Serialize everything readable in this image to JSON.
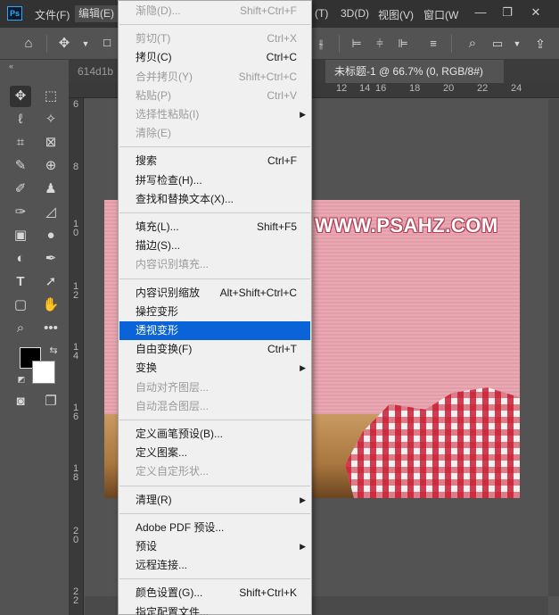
{
  "app": {
    "logo": "Ps",
    "menus": [
      "文件(F)",
      "编辑(E)",
      "(T)",
      "3D(D)",
      "视图(V)",
      "窗口(W"
    ],
    "window_controls": [
      "—",
      "❐",
      "✕"
    ]
  },
  "options_bar": {
    "icons": [
      "home-icon",
      "move-icon",
      "align-icon",
      "search-icon",
      "workspace-icon",
      "share-icon"
    ]
  },
  "tabs": [
    {
      "label": "614d1b",
      "active": false
    },
    {
      "label": "未标题-1 @ 66.7% (0, RGB/8#) *",
      "active": true,
      "close": "✕"
    }
  ],
  "ruler_top": [
    "12",
    "14",
    "16",
    "18",
    "20",
    "22",
    "24"
  ],
  "ruler_left": [
    [
      "6"
    ],
    [
      "8"
    ],
    [
      "1",
      "0"
    ],
    [
      "1",
      "2"
    ],
    [
      "1",
      "4"
    ],
    [
      "1",
      "6"
    ],
    [
      "1",
      "8"
    ],
    [
      "2",
      "0"
    ],
    [
      "2",
      "2"
    ]
  ],
  "canvas": {
    "watermark": "WWW.PSAHZ.COM"
  },
  "edit_menu": [
    {
      "label": "渐隐(D)...",
      "shortcut": "Shift+Ctrl+F",
      "disabled": true
    },
    {
      "sep": true
    },
    {
      "label": "剪切(T)",
      "shortcut": "Ctrl+X",
      "disabled": true
    },
    {
      "label": "拷贝(C)",
      "shortcut": "Ctrl+C",
      "disabled": false
    },
    {
      "label": "合并拷贝(Y)",
      "shortcut": "Shift+Ctrl+C",
      "disabled": true
    },
    {
      "label": "粘贴(P)",
      "shortcut": "Ctrl+V",
      "disabled": true
    },
    {
      "label": "选择性粘贴(I)",
      "shortcut": "",
      "disabled": true,
      "submenu": true
    },
    {
      "label": "清除(E)",
      "shortcut": "",
      "disabled": true
    },
    {
      "sep": true
    },
    {
      "label": "搜索",
      "shortcut": "Ctrl+F",
      "disabled": false
    },
    {
      "label": "拼写检查(H)...",
      "shortcut": "",
      "disabled": false
    },
    {
      "label": "查找和替换文本(X)...",
      "shortcut": "",
      "disabled": false
    },
    {
      "sep": true
    },
    {
      "label": "填充(L)...",
      "shortcut": "Shift+F5",
      "disabled": false
    },
    {
      "label": "描边(S)...",
      "shortcut": "",
      "disabled": false
    },
    {
      "label": "内容识别填充...",
      "shortcut": "",
      "disabled": true
    },
    {
      "sep": true
    },
    {
      "label": "内容识别缩放",
      "shortcut": "Alt+Shift+Ctrl+C",
      "disabled": false
    },
    {
      "label": "操控变形",
      "shortcut": "",
      "disabled": false
    },
    {
      "label": "透视变形",
      "shortcut": "",
      "disabled": false,
      "highlighted": true
    },
    {
      "label": "自由变换(F)",
      "shortcut": "Ctrl+T",
      "disabled": false
    },
    {
      "label": "变换",
      "shortcut": "",
      "disabled": false,
      "submenu": true
    },
    {
      "label": "自动对齐图层...",
      "shortcut": "",
      "disabled": true
    },
    {
      "label": "自动混合图层...",
      "shortcut": "",
      "disabled": true
    },
    {
      "sep": true
    },
    {
      "label": "定义画笔预设(B)...",
      "shortcut": "",
      "disabled": false
    },
    {
      "label": "定义图案...",
      "shortcut": "",
      "disabled": false
    },
    {
      "label": "定义自定形状...",
      "shortcut": "",
      "disabled": true
    },
    {
      "sep": true
    },
    {
      "label": "清理(R)",
      "shortcut": "",
      "disabled": false,
      "submenu": true
    },
    {
      "sep": true
    },
    {
      "label": "Adobe PDF 预设...",
      "shortcut": "",
      "disabled": false
    },
    {
      "label": "预设",
      "shortcut": "",
      "disabled": false,
      "submenu": true
    },
    {
      "label": "远程连接...",
      "shortcut": "",
      "disabled": false
    },
    {
      "sep": true
    },
    {
      "label": "颜色设置(G)...",
      "shortcut": "Shift+Ctrl+K",
      "disabled": false
    },
    {
      "label": "指定配置文件...",
      "shortcut": "",
      "disabled": false
    }
  ],
  "colors": {
    "highlight": "#0a64d8",
    "foreground": "#000000",
    "background": "#ffffff",
    "canvas_pink": "#e8a3ae"
  }
}
